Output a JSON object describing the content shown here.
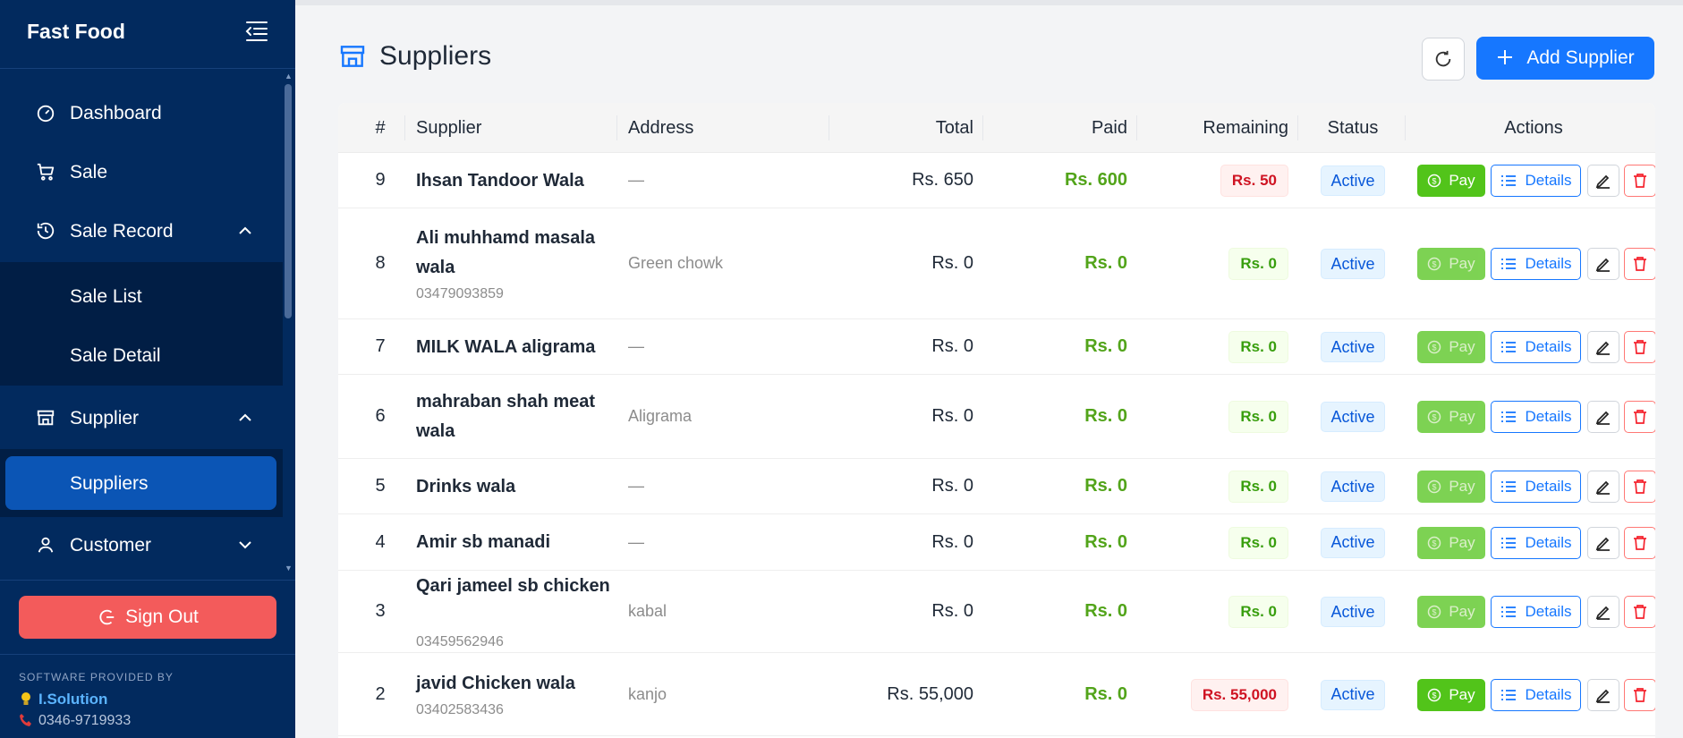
{
  "sidebar": {
    "brand": "Fast Food",
    "items": [
      {
        "label": "Dashboard",
        "icon": "dashboard-icon"
      },
      {
        "label": "Sale",
        "icon": "cart-icon"
      },
      {
        "label": "Sale Record",
        "icon": "history-icon",
        "expanded": true,
        "children": [
          "Sale List",
          "Sale Detail"
        ]
      },
      {
        "label": "Supplier",
        "icon": "store-icon",
        "expanded": true,
        "children": [
          "Suppliers"
        ]
      },
      {
        "label": "Customer",
        "icon": "user-icon",
        "expanded": false
      }
    ],
    "active": "Suppliers",
    "sign_out": "Sign Out",
    "provided_by": "SOFTWARE PROVIDED BY",
    "company": "I.Solution",
    "phone": "0346-9719933"
  },
  "header": {
    "title": "Suppliers",
    "add_label": "Add Supplier"
  },
  "table": {
    "columns": [
      "#",
      "Supplier",
      "Address",
      "Total",
      "Paid",
      "Remaining",
      "Status",
      "Actions"
    ],
    "pay_label": "Pay",
    "details_label": "Details",
    "rows": [
      {
        "num": "9",
        "name": "Ihsan Tandoor Wala",
        "phone": "",
        "address": "—",
        "total": "Rs. 650",
        "paid": "Rs. 600",
        "remaining": "Rs. 50",
        "remaining_type": "due",
        "status": "Active",
        "pay_enabled": true
      },
      {
        "num": "8",
        "name": "Ali muhhamd masala wala",
        "phone": "03479093859",
        "address": "Green chowk",
        "total": "Rs. 0",
        "paid": "Rs. 0",
        "remaining": "Rs. 0",
        "remaining_type": "clear",
        "status": "Active",
        "pay_enabled": false
      },
      {
        "num": "7",
        "name": "MILK WALA aligrama",
        "phone": "",
        "address": "—",
        "total": "Rs. 0",
        "paid": "Rs. 0",
        "remaining": "Rs. 0",
        "remaining_type": "clear",
        "status": "Active",
        "pay_enabled": false
      },
      {
        "num": "6",
        "name": "mahraban shah meat wala",
        "phone": "",
        "address": "Aligrama",
        "total": "Rs. 0",
        "paid": "Rs. 0",
        "remaining": "Rs. 0",
        "remaining_type": "clear",
        "status": "Active",
        "pay_enabled": false
      },
      {
        "num": "5",
        "name": "Drinks wala",
        "phone": "",
        "address": "—",
        "total": "Rs. 0",
        "paid": "Rs. 0",
        "remaining": "Rs. 0",
        "remaining_type": "clear",
        "status": "Active",
        "pay_enabled": false
      },
      {
        "num": "4",
        "name": "Amir sb manadi",
        "phone": "",
        "address": "—",
        "total": "Rs. 0",
        "paid": "Rs. 0",
        "remaining": "Rs. 0",
        "remaining_type": "clear",
        "status": "Active",
        "pay_enabled": false
      },
      {
        "num": "3",
        "name": "Qari jameel sb chicken",
        "phone": "03459562946",
        "address": "kabal",
        "total": "Rs. 0",
        "paid": "Rs. 0",
        "remaining": "Rs. 0",
        "remaining_type": "clear",
        "status": "Active",
        "pay_enabled": false
      },
      {
        "num": "2",
        "name": "javid Chicken wala",
        "phone": "03402583436",
        "address": "kanjo",
        "total": "Rs. 55,000",
        "paid": "Rs. 0",
        "remaining": "Rs. 55,000",
        "remaining_type": "due",
        "status": "Active",
        "pay_enabled": true
      }
    ]
  },
  "colors": {
    "sidebar_bg": "#022a5e",
    "accent": "#1677ff",
    "danger": "#f35b5b",
    "success": "#52c41a"
  }
}
